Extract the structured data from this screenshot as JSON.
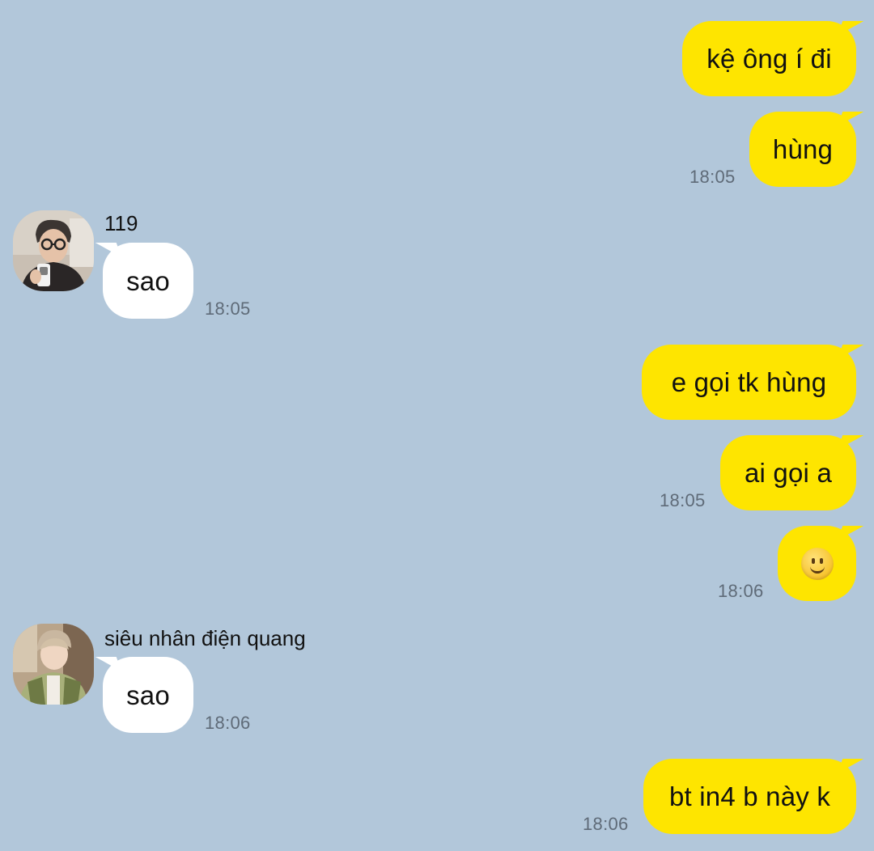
{
  "messages": [
    {
      "dir": "out",
      "text": "kệ ông í đi"
    },
    {
      "dir": "out",
      "text": "hùng",
      "time": "18:05"
    },
    {
      "dir": "in",
      "sender": "119",
      "text": "sao",
      "time": "18:05"
    },
    {
      "dir": "out",
      "text": "e gọi tk hùng"
    },
    {
      "dir": "out",
      "text": "ai gọi a",
      "time": "18:05"
    },
    {
      "dir": "out",
      "emoji": "slightly-smiling-face-icon",
      "time": "18:06"
    },
    {
      "dir": "in",
      "sender": "siêu nhân điện quang",
      "text": "sao",
      "time": "18:06"
    },
    {
      "dir": "out",
      "text": "bt in4 b này k",
      "time": "18:06"
    }
  ],
  "colors": {
    "background": "#b2c7da",
    "outgoing_bubble": "#fee500",
    "incoming_bubble": "#ffffff",
    "timestamp": "#5f6b78"
  }
}
